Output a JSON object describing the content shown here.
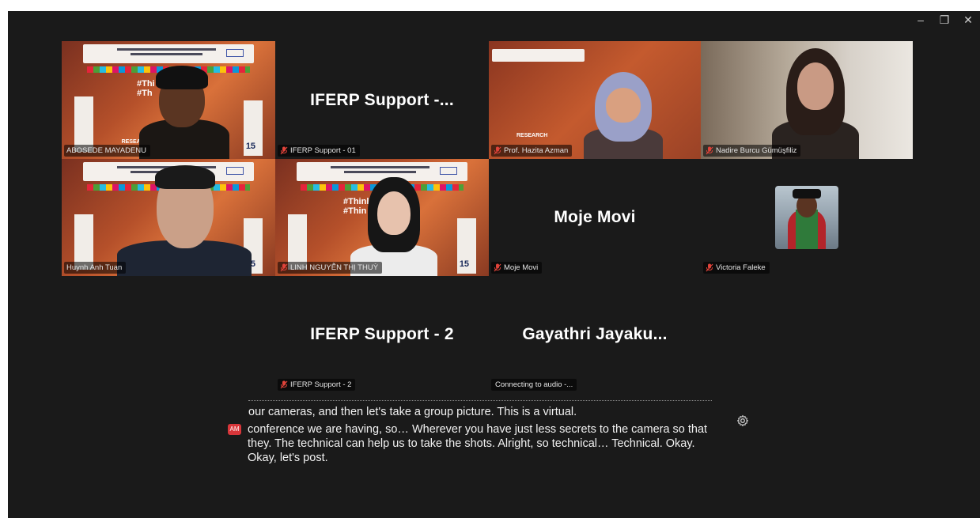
{
  "window": {
    "controls": {
      "minimize": "–",
      "restore": "❐",
      "close": "✕"
    }
  },
  "participants": [
    {
      "id": "abosede",
      "name": "ABOSEDE MAYADENU",
      "type": "video",
      "active": true,
      "muted": false
    },
    {
      "id": "iferp01",
      "name": "IFERP Support - 01",
      "display_name": "IFERP Support -...",
      "type": "name",
      "muted": true
    },
    {
      "id": "hazita",
      "name": "Prof. Hazita Azman",
      "type": "video",
      "muted": true
    },
    {
      "id": "nadire",
      "name": "Nadire Burcu Gümüşfiliz",
      "type": "video",
      "muted": true
    },
    {
      "id": "huynh",
      "name": "Huynh Anh Tuan",
      "type": "video",
      "muted": false
    },
    {
      "id": "linh",
      "name": "LINH NGUYỄN THỊ THUỲ",
      "type": "video",
      "muted": true
    },
    {
      "id": "moje",
      "name": "Moje Movi",
      "display_name": "Moje Movi",
      "type": "name",
      "muted": true
    },
    {
      "id": "victoria",
      "name": "Victoria Faleke",
      "type": "avatar",
      "muted": true
    },
    {
      "id": "iferp2",
      "name": "IFERP Support - 2",
      "display_name": "IFERP Support - 2",
      "type": "name",
      "muted": true
    },
    {
      "id": "gayathri",
      "name": "Connecting to audio -...",
      "display_name": "Gayathri  Jayaku...",
      "type": "name",
      "muted": false
    }
  ],
  "slide": {
    "hashtag_a": "#Thi",
    "hashtag_b": "#Th",
    "hashtag_c": "#Thinl",
    "hashtag_d": "#Thin",
    "research": "RESEARCH",
    "badge": "15"
  },
  "captions": {
    "line1": "our cameras, and then let's take a group picture. This is a virtual.",
    "speaker_badge": "AM",
    "block": "conference we are having, so… Wherever you have just less secrets to the camera so that they. The technical can help us to take the shots. Alright, so technical… Technical. Okay. Okay, let's post."
  },
  "colors": {
    "background": "#1a1a1a",
    "active_border": "#23c552",
    "mute_red": "#e0433a",
    "caption_badge": "#d8363a"
  }
}
